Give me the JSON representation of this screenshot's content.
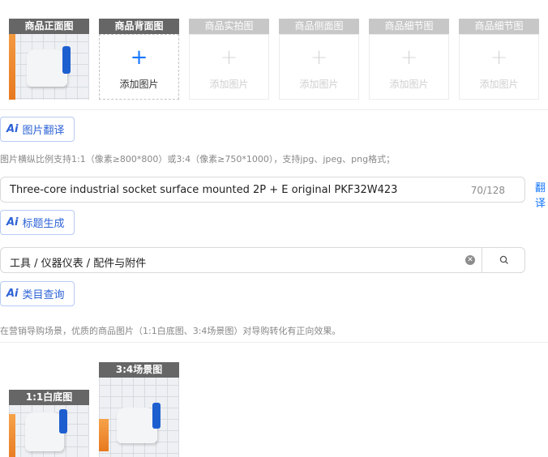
{
  "image_slots": [
    {
      "label": "商品正面图",
      "state": "filled"
    },
    {
      "label": "商品背面图",
      "state": "active",
      "add_label": "添加图片"
    },
    {
      "label": "商品实拍图",
      "state": "disabled",
      "add_label": "添加图片"
    },
    {
      "label": "商品侧面图",
      "state": "disabled",
      "add_label": "添加图片"
    },
    {
      "label": "商品细节图",
      "state": "disabled",
      "add_label": "添加图片"
    },
    {
      "label": "商品细节图",
      "state": "disabled",
      "add_label": "添加图片"
    }
  ],
  "image_translate": {
    "icon": "Ai",
    "label": "图片翻译"
  },
  "image_hint": "图片横纵比例支持1:1（像素≥800*800）或3:4（像素≥750*1000），支持jpg、jpeg、png格式；",
  "title_field": {
    "value": "Three-core industrial socket surface mounted 2P + E original PKF32W423",
    "count": "70/128",
    "translate_link": "翻译"
  },
  "title_generate": {
    "icon": "Ai",
    "label": "标题生成"
  },
  "category_field": {
    "value": "工具 / 仪器仪表 / 配件与附件"
  },
  "category_query": {
    "icon": "Ai",
    "label": "类目查询"
  },
  "marketing_hint": "在营销导购场景，优质的商品图片（1:1白底图、3:4场景图）对导购转化有正向效果。",
  "marketing_images": [
    {
      "label": "1:1白底图"
    },
    {
      "label": "3:4场景图"
    }
  ],
  "colors": {
    "accent": "#1677ff",
    "ai_blue": "#2d62d6",
    "caption_bg": "#666666",
    "caption_disabled": "#c7c7c7"
  }
}
